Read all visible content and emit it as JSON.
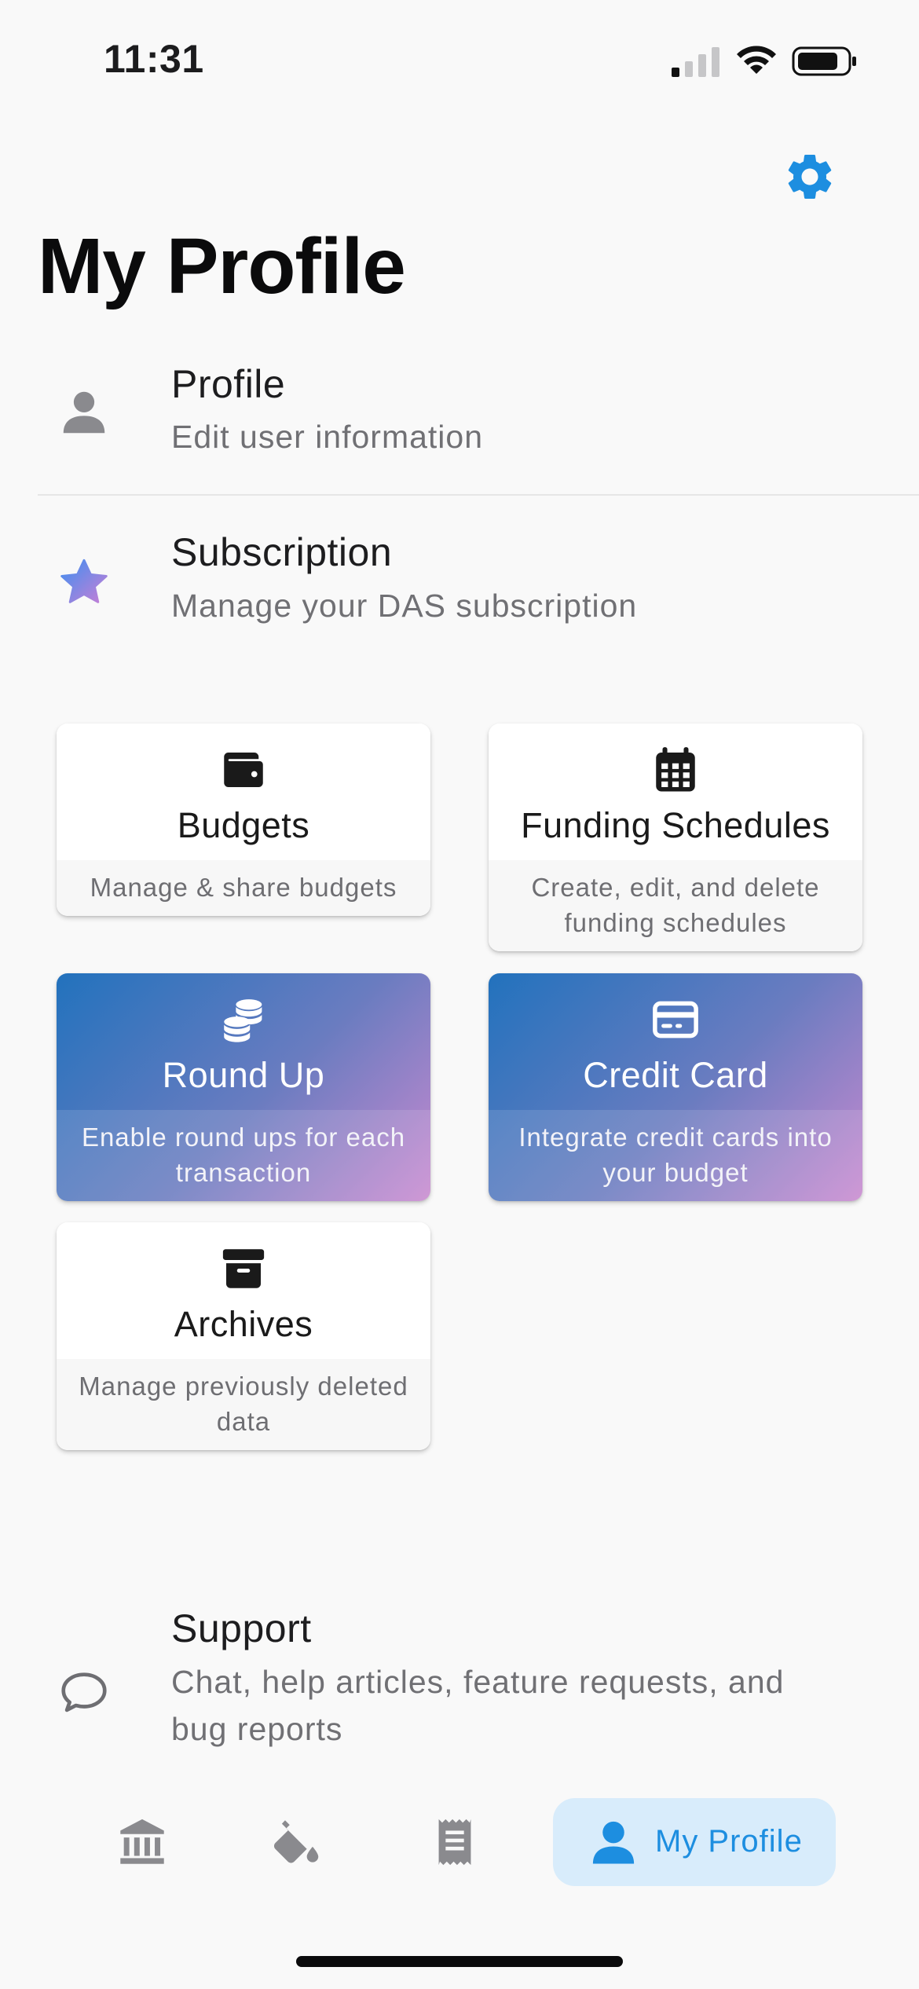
{
  "status_bar": {
    "time": "11:31"
  },
  "header": {
    "title": "My Profile"
  },
  "rows": [
    {
      "title": "Profile",
      "subtitle": "Edit user information"
    },
    {
      "title": "Subscription",
      "subtitle": "Manage your DAS subscription"
    },
    {
      "title": "Support",
      "subtitle_line1": "Chat, help articles, feature requests, and",
      "subtitle_line2": "bug reports"
    }
  ],
  "cards": [
    {
      "title": "Budgets",
      "subtitle_line1": "Manage & share budgets",
      "subtitle_line2": "",
      "icon": "wallet-icon"
    },
    {
      "title": "Funding Schedules",
      "subtitle_line1": "Create, edit, and delete",
      "subtitle_line2": "funding schedules",
      "icon": "calendar-icon"
    },
    {
      "title": "Round Up",
      "subtitle_line1": "Enable round ups for each",
      "subtitle_line2": "transaction",
      "icon": "coins-icon"
    },
    {
      "title": "Credit Card",
      "subtitle_line1": "Integrate credit cards into",
      "subtitle_line2": "your budget",
      "icon": "credit-card-icon"
    },
    {
      "title": "Archives",
      "subtitle_line1": "Manage previously deleted",
      "subtitle_line2": "data",
      "icon": "archive-box-icon"
    }
  ],
  "bottom_nav": {
    "items": [
      "bank-icon",
      "paint-bucket-icon",
      "receipt-icon",
      "person-icon"
    ],
    "active_label": "My Profile"
  },
  "colors": {
    "accent": "#1d8ee0",
    "active_pill": "#d8ecfb",
    "gradient_start": "#2272bd",
    "gradient_end": "#c98ad0"
  }
}
